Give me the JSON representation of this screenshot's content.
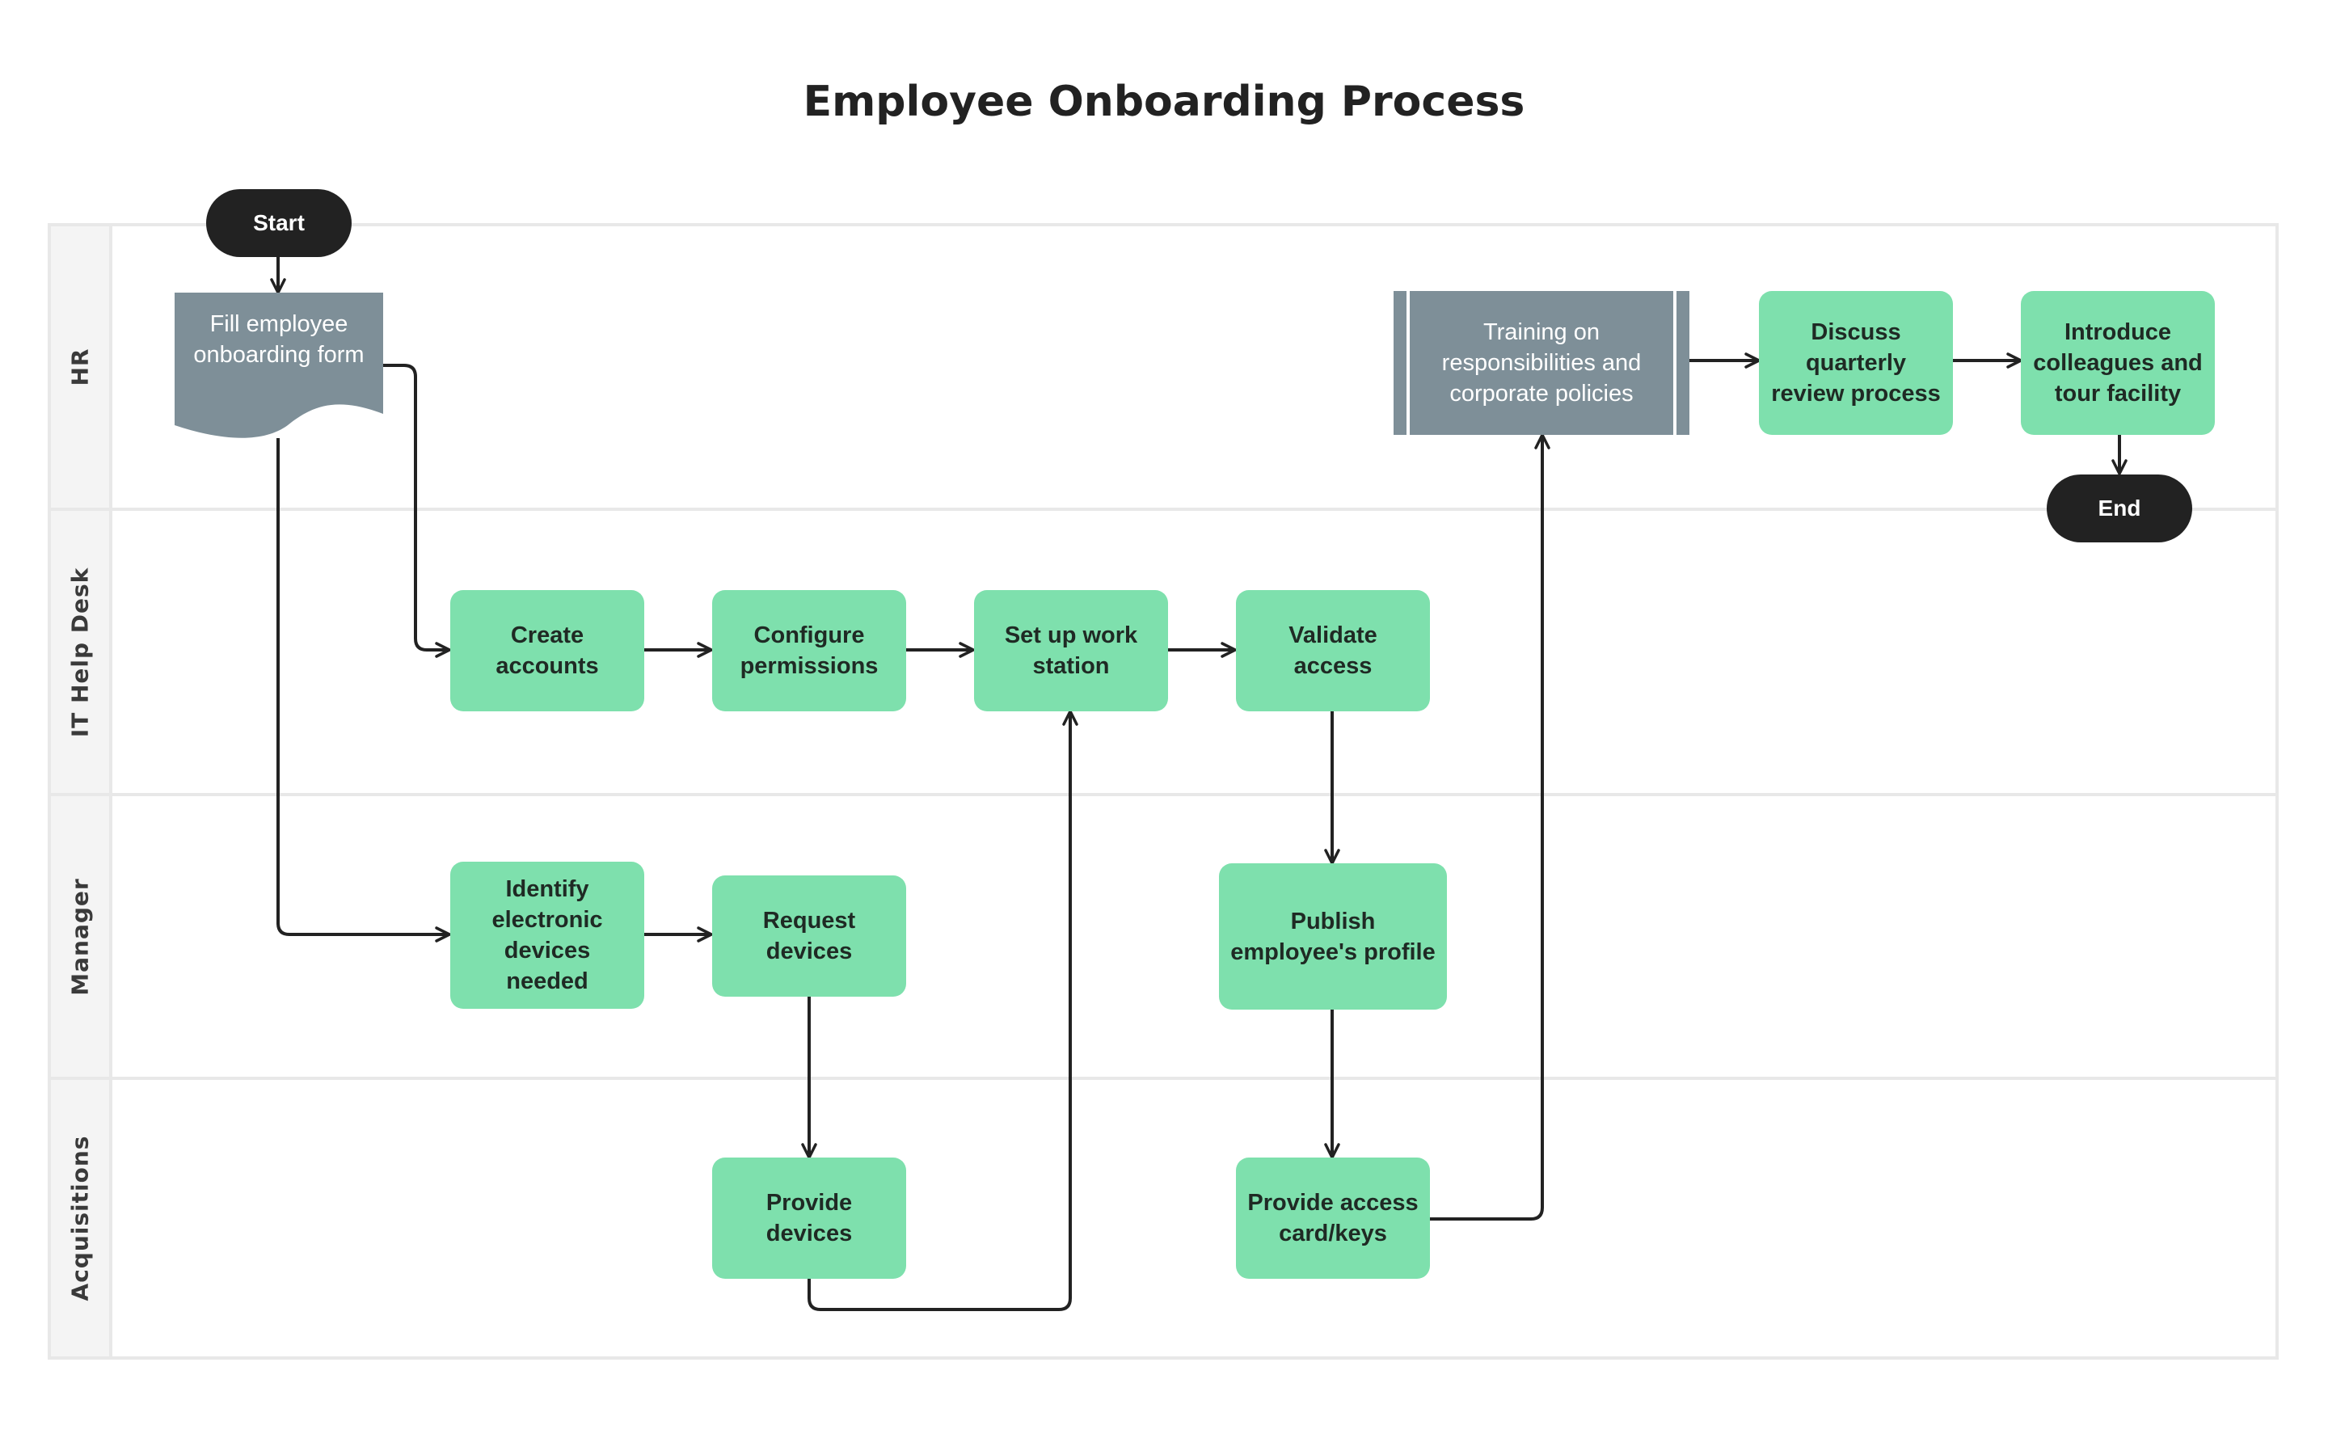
{
  "title": "Employee Onboarding Process",
  "colors": {
    "task_fill": "#7ee0ad",
    "subprocess_fill": "#7e8f98",
    "document_fill": "#7e8f98",
    "terminal_fill": "#222222",
    "edge_color": "#222222",
    "lane_border": "#e8e8e8",
    "lane_header_bg": "#f4f4f4"
  },
  "lanes": [
    {
      "id": "hr",
      "label": "HR"
    },
    {
      "id": "it",
      "label": "IT Help Desk"
    },
    {
      "id": "manager",
      "label": "Manager"
    },
    {
      "id": "acquisitions",
      "label": "Acquisitions"
    }
  ],
  "nodes": {
    "start": {
      "label": "Start",
      "type": "terminal",
      "lane": "hr"
    },
    "fill_form": {
      "label": "Fill employee onboarding form",
      "type": "document",
      "lane": "hr"
    },
    "training": {
      "label": "Training on responsibilities and corporate policies",
      "type": "subprocess",
      "lane": "hr"
    },
    "discuss": {
      "label": "Discuss quarterly review process",
      "type": "task",
      "lane": "hr"
    },
    "introduce": {
      "label": "Introduce colleagues and tour facility",
      "type": "task",
      "lane": "hr"
    },
    "end": {
      "label": "End",
      "type": "terminal",
      "lane": "hr"
    },
    "create_accounts": {
      "label": "Create accounts",
      "type": "task",
      "lane": "it"
    },
    "configure": {
      "label": "Configure permissions",
      "type": "task",
      "lane": "it"
    },
    "setup": {
      "label": "Set up work station",
      "type": "task",
      "lane": "it"
    },
    "validate": {
      "label": "Validate access",
      "type": "task",
      "lane": "it"
    },
    "identify": {
      "label": "Identify electronic devices needed",
      "type": "task",
      "lane": "manager"
    },
    "request": {
      "label": "Request devices",
      "type": "task",
      "lane": "manager"
    },
    "publish": {
      "label": "Publish employee's profile",
      "type": "task",
      "lane": "manager"
    },
    "provide_devices": {
      "label": "Provide devices",
      "type": "task",
      "lane": "acquisitions"
    },
    "provide_access": {
      "label": "Provide access card/keys",
      "type": "task",
      "lane": "acquisitions"
    }
  },
  "edges": [
    {
      "from": "start",
      "to": "fill_form"
    },
    {
      "from": "fill_form",
      "to": "create_accounts"
    },
    {
      "from": "fill_form",
      "to": "identify"
    },
    {
      "from": "create_accounts",
      "to": "configure"
    },
    {
      "from": "configure",
      "to": "setup"
    },
    {
      "from": "setup",
      "to": "validate"
    },
    {
      "from": "identify",
      "to": "request"
    },
    {
      "from": "request",
      "to": "provide_devices"
    },
    {
      "from": "provide_devices",
      "to": "setup"
    },
    {
      "from": "validate",
      "to": "publish"
    },
    {
      "from": "publish",
      "to": "provide_access"
    },
    {
      "from": "provide_access",
      "to": "training"
    },
    {
      "from": "training",
      "to": "discuss"
    },
    {
      "from": "discuss",
      "to": "introduce"
    },
    {
      "from": "introduce",
      "to": "end"
    }
  ]
}
